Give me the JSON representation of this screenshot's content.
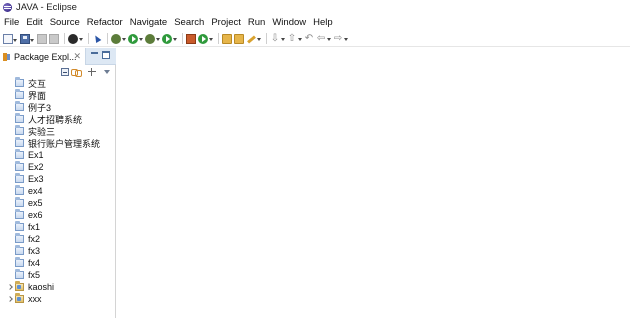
{
  "window": {
    "title": "JAVA - Eclipse"
  },
  "menu": [
    "File",
    "Edit",
    "Source",
    "Refactor",
    "Navigate",
    "Search",
    "Project",
    "Run",
    "Window",
    "Help"
  ],
  "toolbar": {
    "icons": [
      "new-icon",
      "save-icon",
      "print-icon",
      "terminal-icon",
      "cursor-icon",
      "debug-icon",
      "run-icon",
      "coverage-icon",
      "external-tools-icon",
      "new-java-project-icon",
      "new-class-icon",
      "open-type-icon",
      "open-task-icon",
      "pencil-icon",
      "next-annotation-icon",
      "prev-annotation-icon",
      "back-icon",
      "forward-icon"
    ]
  },
  "package_explorer": {
    "title": "Package Expl...",
    "close_glyph": "✕",
    "items": [
      {
        "label": "交互",
        "kind": "project",
        "expandable": false
      },
      {
        "label": "界面",
        "kind": "project",
        "expandable": false
      },
      {
        "label": "例子3",
        "kind": "project",
        "expandable": false
      },
      {
        "label": "人才招聘系统",
        "kind": "project",
        "expandable": false
      },
      {
        "label": "实验三",
        "kind": "project",
        "expandable": false
      },
      {
        "label": "银行账户管理系统",
        "kind": "project",
        "expandable": false
      },
      {
        "label": "Ex1",
        "kind": "project",
        "expandable": false
      },
      {
        "label": "Ex2",
        "kind": "project",
        "expandable": false
      },
      {
        "label": "Ex3",
        "kind": "project",
        "expandable": false
      },
      {
        "label": "ex4",
        "kind": "project",
        "expandable": false
      },
      {
        "label": "ex5",
        "kind": "project",
        "expandable": false
      },
      {
        "label": "ex6",
        "kind": "project",
        "expandable": false
      },
      {
        "label": "fx1",
        "kind": "project",
        "expandable": false
      },
      {
        "label": "fx2",
        "kind": "project",
        "expandable": false
      },
      {
        "label": "fx3",
        "kind": "project",
        "expandable": false
      },
      {
        "label": "fx4",
        "kind": "project",
        "expandable": false
      },
      {
        "label": "fx5",
        "kind": "project",
        "expandable": false
      },
      {
        "label": "kaoshi",
        "kind": "java-project",
        "expandable": true
      },
      {
        "label": "xxx",
        "kind": "java-project",
        "expandable": true
      }
    ]
  },
  "colors": {
    "view_header": "#dde8f4",
    "accent": "#4a6c9a"
  }
}
